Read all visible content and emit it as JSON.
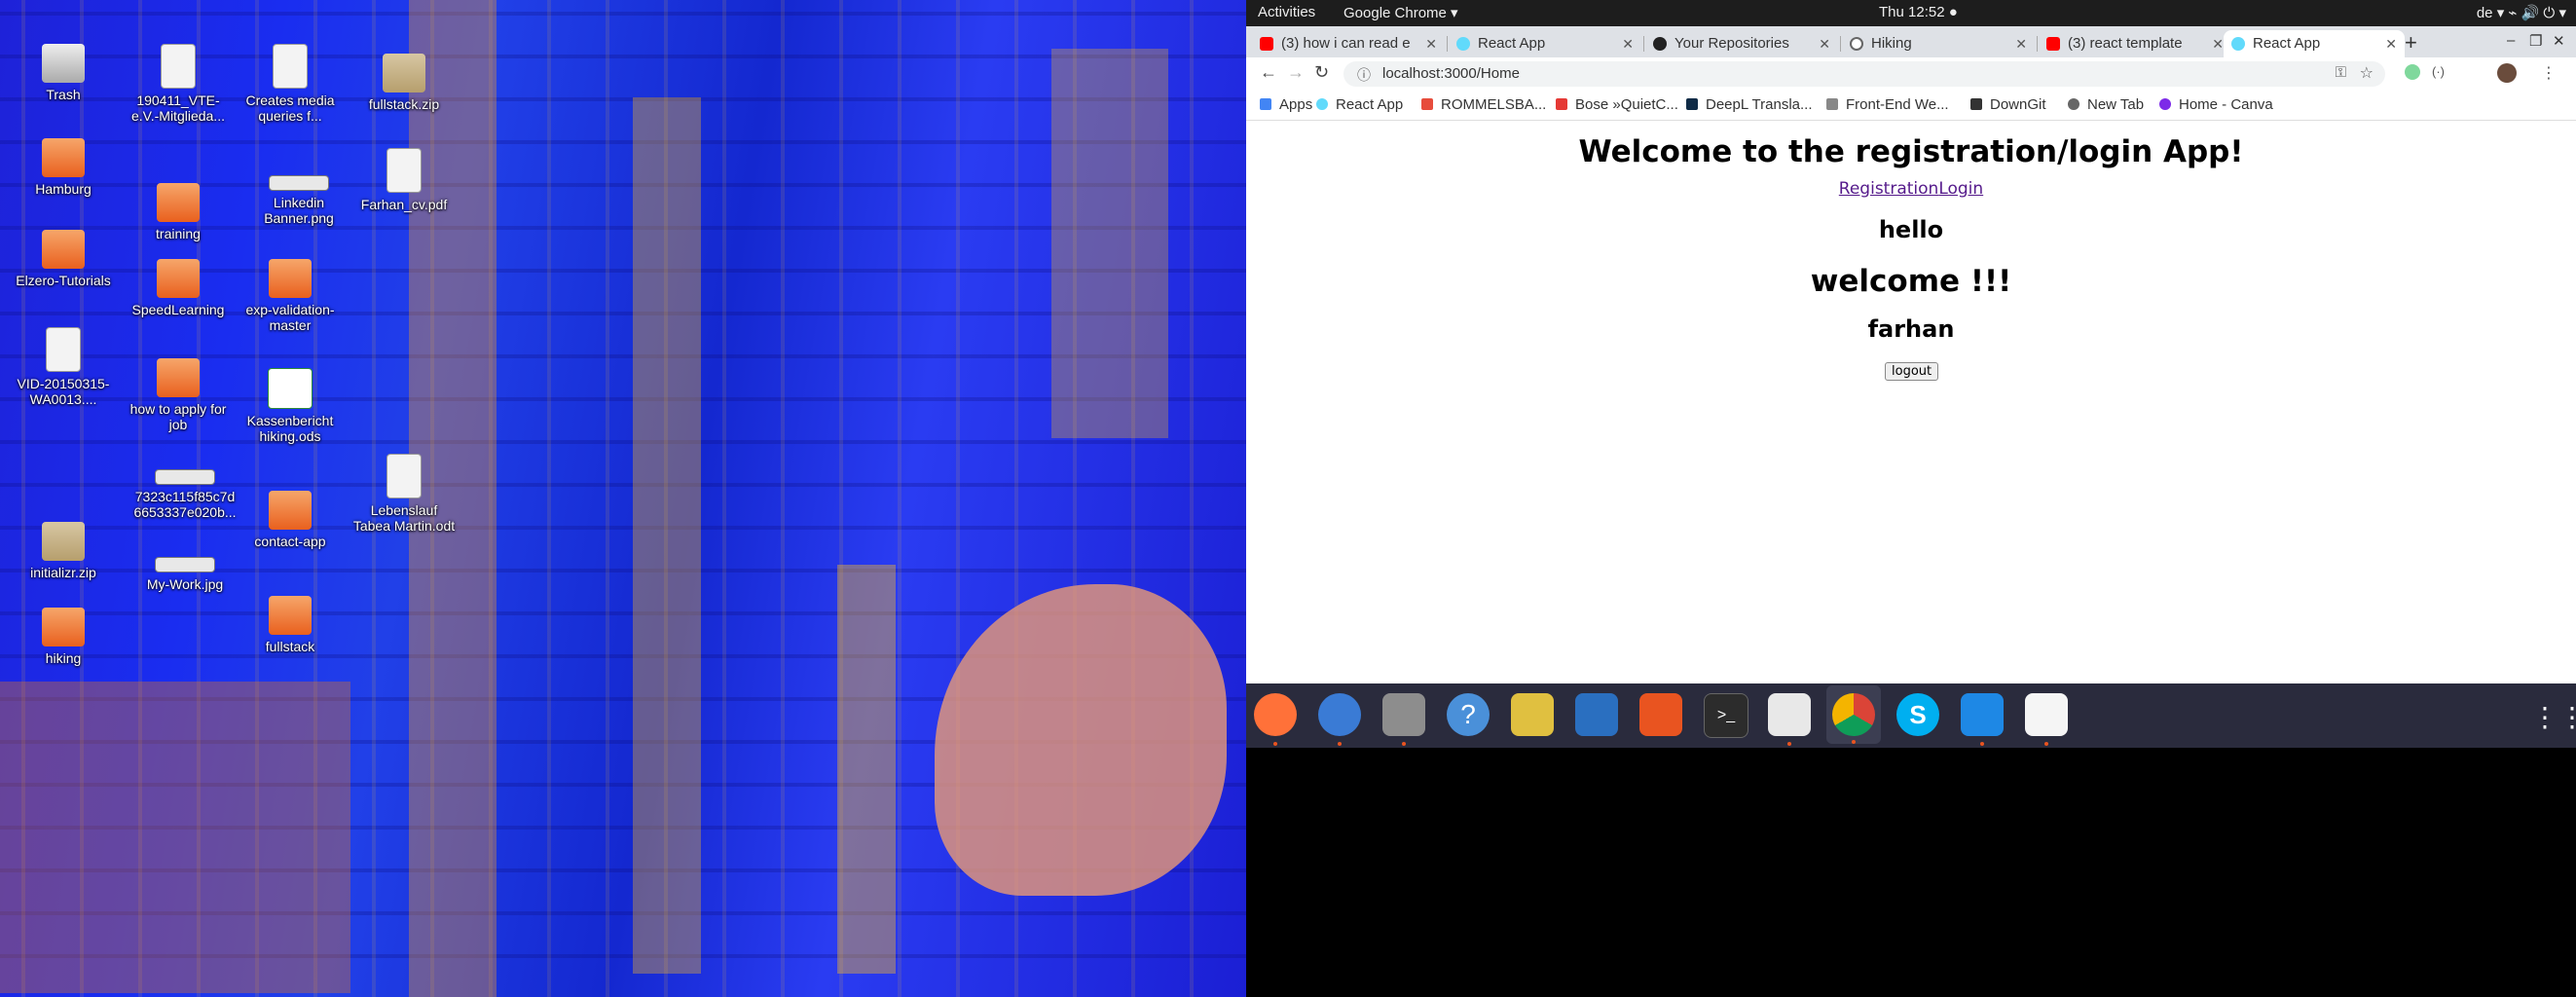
{
  "desktop": {
    "icons": [
      {
        "label": "Trash",
        "type": "trash"
      },
      {
        "label": "190411_VTE-e.V.-Mitglieda...",
        "type": "doc"
      },
      {
        "label": "Creates media queries f...",
        "type": "doc"
      },
      {
        "label": "fullstack.zip",
        "type": "zip"
      },
      {
        "label": "Hamburg",
        "type": "folder"
      },
      {
        "label": "training",
        "type": "folder"
      },
      {
        "label": "Linkedin Banner.png",
        "type": "image"
      },
      {
        "label": "Farhan_cv.pdf",
        "type": "doc"
      },
      {
        "label": "Elzero-Tutorials",
        "type": "folder"
      },
      {
        "label": "SpeedLearning",
        "type": "folder"
      },
      {
        "label": "exp-validation-master",
        "type": "folder"
      },
      {
        "label": "VID-20150315-WA0013....",
        "type": "video"
      },
      {
        "label": "how to apply for job",
        "type": "folder"
      },
      {
        "label": "Kassenbericht hiking.ods",
        "type": "sheet"
      },
      {
        "label": "7323c115f85c7d6653337e020b...",
        "type": "image"
      },
      {
        "label": "Lebenslauf Tabea Martin.odt",
        "type": "doc"
      },
      {
        "label": "initializr.zip",
        "type": "zip"
      },
      {
        "label": "contact-app",
        "type": "folder"
      },
      {
        "label": "My-Work.jpg",
        "type": "image"
      },
      {
        "label": "hiking",
        "type": "folder"
      },
      {
        "label": "fullstack",
        "type": "folder"
      }
    ]
  },
  "topbar": {
    "activities": "Activities",
    "app_name": "Google Chrome ▾",
    "clock": "Thu 12:52 ●",
    "tray": "de ▾   ⌁  🔊  ⏻ ▾"
  },
  "browser": {
    "tabs": [
      {
        "title": "(3) how i can read e",
        "icon_color": "#ff0000",
        "active": false
      },
      {
        "title": "React App",
        "icon_color": "#61dafb",
        "active": false
      },
      {
        "title": "Your Repositories",
        "icon_color": "#222222",
        "active": false
      },
      {
        "title": "Hiking",
        "icon_color": "#666666",
        "active": false
      },
      {
        "title": "(3) react template",
        "icon_color": "#ff0000",
        "active": false
      },
      {
        "title": "React App",
        "icon_color": "#61dafb",
        "active": true
      }
    ],
    "new_tab": "+",
    "url": "localhost:3000/Home",
    "bookmarks": [
      {
        "label": "Apps",
        "color": "#4285f4"
      },
      {
        "label": "React App",
        "color": "#61dafb"
      },
      {
        "label": "ROMMELSBA...",
        "color": "#e74c3c"
      },
      {
        "label": "Bose »QuietC...",
        "color": "#e53935"
      },
      {
        "label": "DeepL Transla...",
        "color": "#0f2b46"
      },
      {
        "label": "Front-End We...",
        "color": "#888888"
      },
      {
        "label": "DownGit",
        "color": "#333333"
      },
      {
        "label": "New Tab",
        "color": "#666666"
      },
      {
        "label": "Home - Canva",
        "color": "#7d2ae8"
      }
    ]
  },
  "page": {
    "heading": "Welcome to the registration/login App!",
    "nav_registration": "Registration",
    "nav_login": "Login",
    "hello": "hello",
    "welcome": "welcome !!!",
    "username": "farhan",
    "logout_label": "logout"
  },
  "dock": {
    "apps": [
      {
        "name": "firefox-icon",
        "color": "#ff7139",
        "running": true
      },
      {
        "name": "thunderbird-icon",
        "color": "#3a7bd5",
        "running": true
      },
      {
        "name": "files-icon",
        "color": "#8d8d8d",
        "running": true
      },
      {
        "name": "help-icon",
        "color": "#4a90d9",
        "running": false
      },
      {
        "name": "rhythmbox-icon",
        "color": "#e0c040",
        "running": false
      },
      {
        "name": "writer-icon",
        "color": "#2a6fc0",
        "running": false
      },
      {
        "name": "software-icon",
        "color": "#e95420",
        "running": false
      },
      {
        "name": "terminal-icon",
        "color": "#2c2c2c",
        "running": false
      },
      {
        "name": "slack-icon",
        "color": "#e8e8e8",
        "running": true
      },
      {
        "name": "chrome-icon",
        "color": "#4caf50",
        "running": true
      },
      {
        "name": "skype-icon",
        "color": "#00aff0",
        "running": false
      },
      {
        "name": "vscode-icon",
        "color": "#1e88e5",
        "running": true
      },
      {
        "name": "document-viewer-icon",
        "color": "#f5f5f5",
        "running": true
      }
    ],
    "app_grid": "⋮⋮⋮"
  }
}
